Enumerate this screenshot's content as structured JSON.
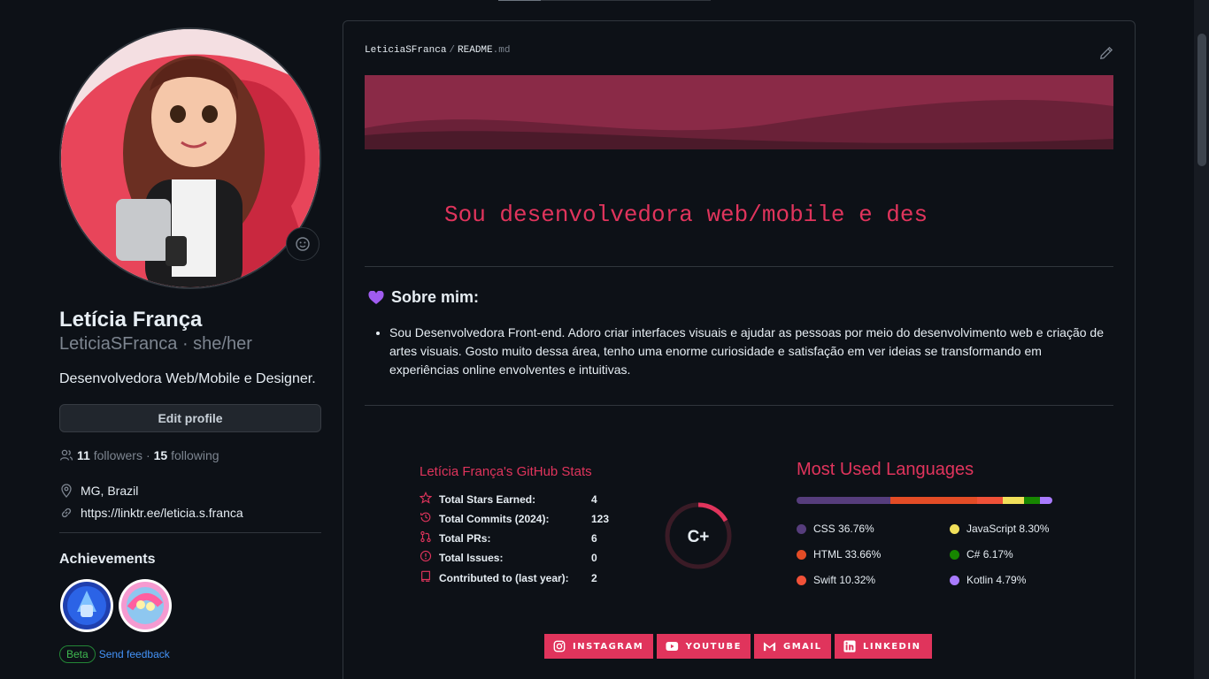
{
  "profile": {
    "name": "Letícia França",
    "login_line": "LeticiaSFranca · she/her",
    "bio": "Desenvolvedora Web/Mobile e Designer.",
    "edit_label": "Edit profile",
    "followers_count": "11",
    "followers_label": "followers",
    "separator": "·",
    "following_count": "15",
    "following_label": "following",
    "location": "MG, Brazil",
    "link": "https://linktr.ee/leticia.s.franca",
    "achievements_title": "Achievements",
    "beta_label": "Beta",
    "feedback_label": "Send feedback"
  },
  "readme": {
    "owner": "LeticiaSFranca",
    "path_sep": "/",
    "file": "README",
    "ext": ".md",
    "typing_text": "Sou desenvolvedora web/mobile e des",
    "about_title": "Sobre mim:",
    "about_text": "Sou Desenvolvedora Front-end. Adoro criar interfaces visuais e ajudar as pessoas por meio do desenvolvimento web e criação de artes visuais. Gosto muito dessa área, tenho uma enorme curiosidade e satisfação em ver ideias se transformando em experiências online envolventes e intuitivas."
  },
  "stats": {
    "title": "Letícia França's GitHub Stats",
    "rows": [
      {
        "label": "Total Stars Earned:",
        "value": "4",
        "icon": "star-icon"
      },
      {
        "label": "Total Commits (2024):",
        "value": "123",
        "icon": "history-icon"
      },
      {
        "label": "Total PRs:",
        "value": "6",
        "icon": "pull-request-icon"
      },
      {
        "label": "Total Issues:",
        "value": "0",
        "icon": "issue-icon"
      },
      {
        "label": "Contributed to (last year):",
        "value": "2",
        "icon": "repo-icon"
      }
    ],
    "rank": "C+",
    "accent": "#e0345c"
  },
  "languages": {
    "title": "Most Used Languages",
    "items": [
      {
        "name": "CSS",
        "pct": "36.76%",
        "value": 36.76,
        "color": "#563d7c"
      },
      {
        "name": "HTML",
        "pct": "33.66%",
        "value": 33.66,
        "color": "#e34c26"
      },
      {
        "name": "Swift",
        "pct": "10.32%",
        "value": 10.32,
        "color": "#F05138"
      },
      {
        "name": "JavaScript",
        "pct": "8.30%",
        "value": 8.3,
        "color": "#f1e05a"
      },
      {
        "name": "C#",
        "pct": "6.17%",
        "value": 6.17,
        "color": "#178600"
      },
      {
        "name": "Kotlin",
        "pct": "4.79%",
        "value": 4.79,
        "color": "#A97BFF"
      }
    ]
  },
  "socials": [
    {
      "label": "INSTAGRAM",
      "icon": "instagram-icon"
    },
    {
      "label": "YOUTUBE",
      "icon": "youtube-icon"
    },
    {
      "label": "GMAIL",
      "icon": "gmail-icon"
    },
    {
      "label": "LINKEDIN",
      "icon": "linkedin-icon"
    }
  ]
}
